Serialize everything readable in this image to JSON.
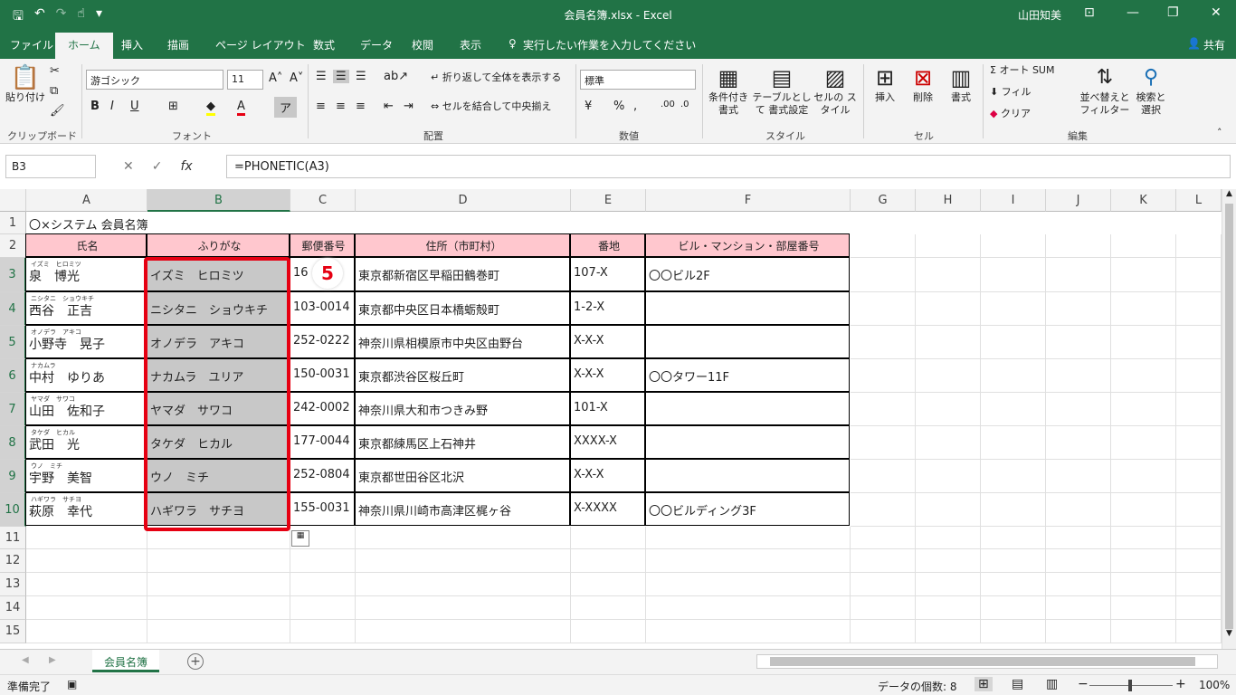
{
  "window": {
    "title": "会員名簿.xlsx  -  Excel",
    "user": "山田知美"
  },
  "tabs": [
    "ファイル",
    "ホーム",
    "挿入",
    "描画",
    "ページ レイアウト",
    "数式",
    "データ",
    "校閲",
    "表示"
  ],
  "tell_me": "実行したい作業を入力してください",
  "share": "共有",
  "ribbon": {
    "paste": "貼り付け",
    "clipboard": "クリップボード",
    "font_name": "游ゴシック",
    "font_size": "11",
    "font_group": "フォント",
    "wrap_text": "折り返して全体を表示する",
    "merge_center": "セルを結合して中央揃え",
    "alignment_group": "配置",
    "number_format": "標準",
    "number_group": "数値",
    "cond_format": "条件付き 書式",
    "table_format": "テーブルとして 書式設定",
    "cell_style": "セルの スタイル",
    "styles_group": "スタイル",
    "insert": "挿入",
    "delete": "削除",
    "format": "書式",
    "cells_group": "セル",
    "autosum": "オート SUM",
    "fill": "フィル",
    "clear": "クリア",
    "sort_filter": "並べ替えと フィルター",
    "find_select": "検索と 選択",
    "editing_group": "編集"
  },
  "formula_bar": {
    "name_box": "B3",
    "formula": "=PHONETIC(A3)"
  },
  "columns": [
    "A",
    "B",
    "C",
    "D",
    "E",
    "F",
    "G",
    "H",
    "I",
    "J",
    "K",
    "L"
  ],
  "rows": [
    "1",
    "2",
    "3",
    "4",
    "5",
    "6",
    "7",
    "8",
    "9",
    "10",
    "11",
    "12",
    "13",
    "14",
    "15"
  ],
  "sheet": {
    "title": "〇×システム 会員名簿",
    "headers": [
      "氏名",
      "ふりがな",
      "郵便番号",
      "住所（市町村）",
      "番地",
      "ビル・マンション・部屋番号"
    ],
    "records": [
      {
        "ruby": "イズミ　ヒロミツ",
        "name": "泉　博光",
        "kana": "イズミ　ヒロミツ",
        "zip": "16",
        "addr": "東京都新宿区早稲田鶴巻町",
        "num": "107-X",
        "bldg": "〇〇ビル2F"
      },
      {
        "ruby": "ニシタニ　ショウキチ",
        "name": "西谷　正吉",
        "kana": "ニシタニ　ショウキチ",
        "zip": "103-0014",
        "addr": "東京都中央区日本橋蛎殻町",
        "num": "1-2-X",
        "bldg": ""
      },
      {
        "ruby": "オノデラ　アキコ",
        "name": "小野寺　晃子",
        "kana": "オノデラ　アキコ",
        "zip": "252-0222",
        "addr": "神奈川県相模原市中央区由野台",
        "num": "X-X-X",
        "bldg": ""
      },
      {
        "ruby": "ナカムラ",
        "name": "中村　ゆりあ",
        "kana": "ナカムラ　ユリア",
        "zip": "150-0031",
        "addr": "東京都渋谷区桜丘町",
        "num": "X-X-X",
        "bldg": "〇〇タワー11F"
      },
      {
        "ruby": "ヤマダ　サワコ",
        "name": "山田　佐和子",
        "kana": "ヤマダ　サワコ",
        "zip": "242-0002",
        "addr": "神奈川県大和市つきみ野",
        "num": "101-X",
        "bldg": ""
      },
      {
        "ruby": "タケダ　ヒカル",
        "name": "武田　光",
        "kana": "タケダ　ヒカル",
        "zip": "177-0044",
        "addr": "東京都練馬区上石神井",
        "num": "XXXX-X",
        "bldg": ""
      },
      {
        "ruby": "ウノ　ミチ",
        "name": "宇野　美智",
        "kana": "ウノ　ミチ",
        "zip": "252-0804",
        "addr": "東京都世田谷区北沢",
        "num": "X-X-X",
        "bldg": ""
      },
      {
        "ruby": "ハギワラ　サチヨ",
        "name": "萩原　幸代",
        "kana": "ハギワラ　サチヨ",
        "zip": "155-0031",
        "addr": "神奈川県川崎市高津区梶ヶ谷",
        "num": "X-XXXX",
        "bldg": "〇〇ビルディング3F"
      }
    ]
  },
  "annotation": {
    "step": "5"
  },
  "sheet_tab": "会員名簿",
  "status": {
    "ready": "準備完了",
    "count": "データの個数: 8",
    "zoom": "100%"
  },
  "colors": {
    "accent": "#217346",
    "header_fill": "#ffc7ce",
    "highlight": "#e60012"
  }
}
